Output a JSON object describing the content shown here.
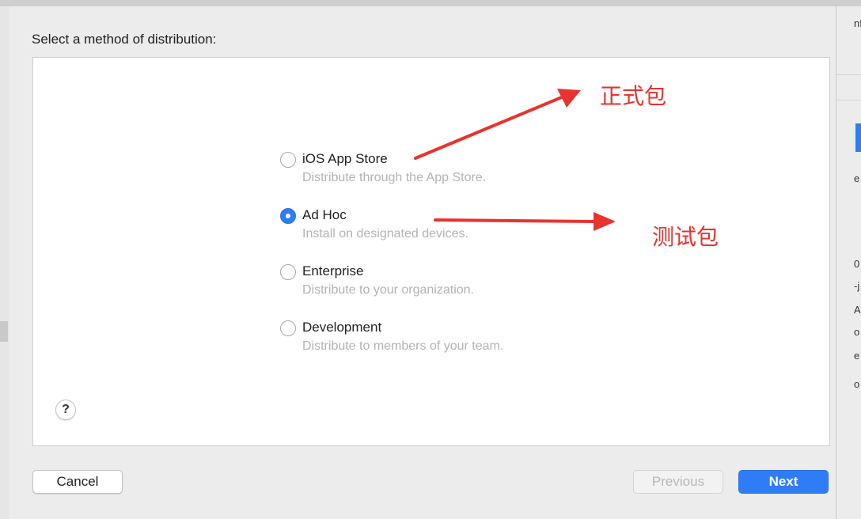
{
  "dialog": {
    "heading": "Select a method of distribution:",
    "options": [
      {
        "title": "iOS App Store",
        "description": "Distribute through the App Store.",
        "selected": false
      },
      {
        "title": "Ad Hoc",
        "description": "Install on designated devices.",
        "selected": true
      },
      {
        "title": "Enterprise",
        "description": "Distribute to your organization.",
        "selected": false
      },
      {
        "title": "Development",
        "description": "Distribute to members of your team.",
        "selected": false
      }
    ],
    "help_label": "?",
    "buttons": {
      "cancel": "Cancel",
      "previous": "Previous",
      "next": "Next"
    }
  },
  "annotations": {
    "release_label": "正式包",
    "test_label": "测试包",
    "color": "#e8332f"
  },
  "background": {
    "fragments": [
      "nf",
      "e",
      "0",
      "-j",
      "A",
      "o",
      "e",
      "o"
    ]
  },
  "colors": {
    "accent": "#2f7df6",
    "sheet": "#ececec",
    "panel": "#ffffff"
  }
}
